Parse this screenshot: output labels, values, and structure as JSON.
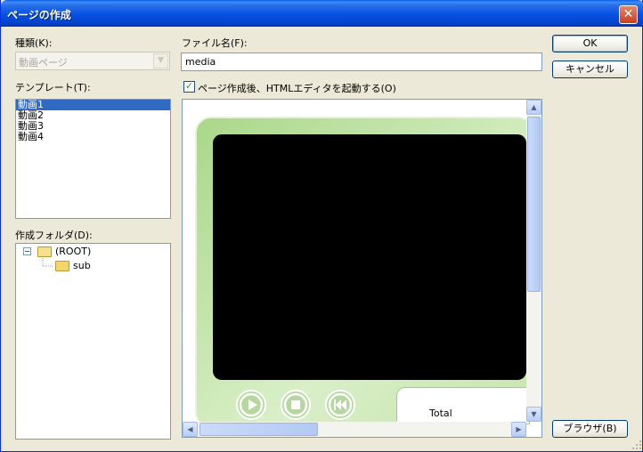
{
  "window": {
    "title": "ページの作成",
    "close_label": "✕"
  },
  "type": {
    "label": "種類(K):",
    "value": "動画ページ"
  },
  "template": {
    "label": "テンプレート(T):",
    "items": [
      "動画1",
      "動画2",
      "動画3",
      "動画4"
    ]
  },
  "folder": {
    "label": "作成フォルダ(D):",
    "root": "(ROOT)",
    "child": "sub",
    "expander": "−"
  },
  "filename": {
    "label": "ファイル名(F):",
    "value": "media"
  },
  "open_editor": {
    "label": "ページ作成後、HTMLエディタを起動する(O)",
    "checked": true
  },
  "buttons": {
    "ok": "OK",
    "cancel": "キャンセル",
    "browse": "ブラウザ(B)"
  },
  "preview": {
    "total_label": "Total"
  },
  "colors": {
    "titlebar": "#0551e4",
    "selection": "#316ac5",
    "player_green": "#aad789"
  }
}
